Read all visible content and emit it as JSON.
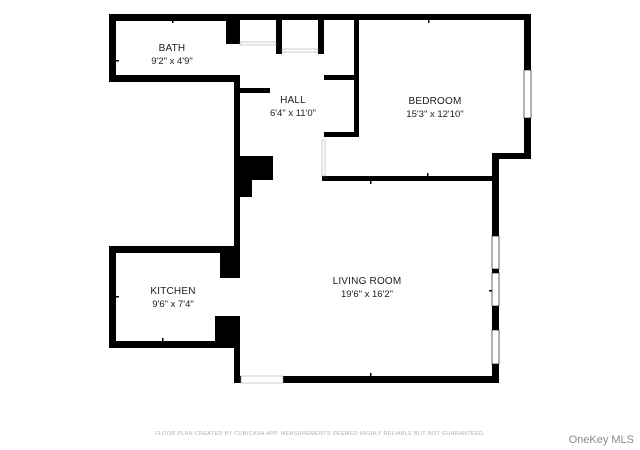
{
  "rooms": {
    "bath": {
      "name": "BATH",
      "dimensions": "9'2\" x 4'9\""
    },
    "hall": {
      "name": "HALL",
      "dimensions": "6'4\" x 11'0\""
    },
    "bedroom": {
      "name": "BEDROOM",
      "dimensions": "15'3\" x 12'10\""
    },
    "kitchen": {
      "name": "KITCHEN",
      "dimensions": "9'6\" x 7'4\""
    },
    "living_room": {
      "name": "LIVING ROOM",
      "dimensions": "19'6\" x 16'2\""
    }
  },
  "footer_note": "FLOOR PLAN CREATED BY CUBICASA APP. MEASUREMENTS DEEMED HIGHLY RELIABLE BUT NOT GUARANTEED.",
  "watermark": "OneKey MLS",
  "colors": {
    "wall": "#000000",
    "window": "#ffffff",
    "text": "#1c1c1c"
  }
}
